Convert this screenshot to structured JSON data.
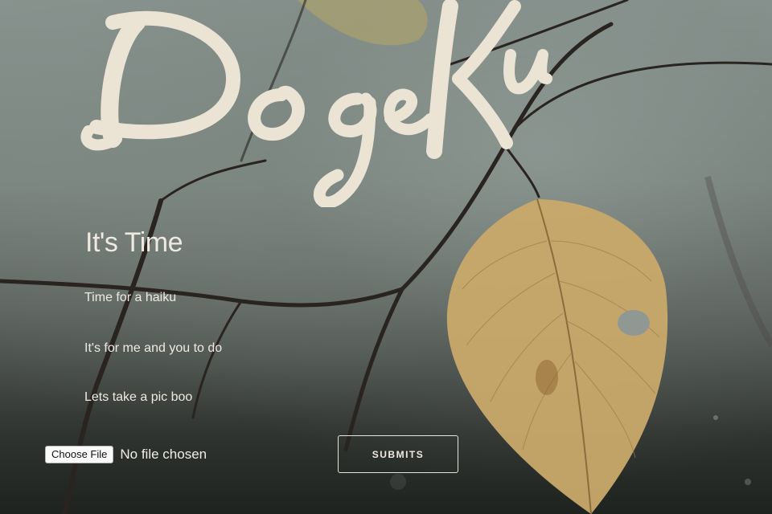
{
  "brand": {
    "logo_text": "DogeKu"
  },
  "form": {
    "heading": "It's Time",
    "lines": [
      "Time for a haiku",
      "It's for me and you to do",
      "Lets take a pic boo"
    ],
    "file_button_label": "Choose File",
    "file_status": "No file chosen",
    "submit_label": "SUBMITS"
  },
  "colors": {
    "text": "#efeae1",
    "leaf": "#c9a96a"
  }
}
